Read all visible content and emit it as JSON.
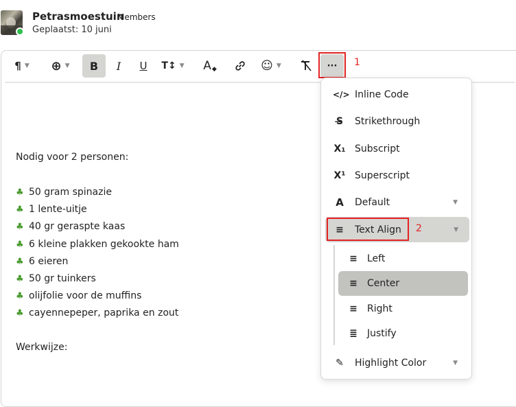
{
  "post": {
    "username": "Petrasmoestuin",
    "role": "Members",
    "posted": "Geplaatst: 10 juni"
  },
  "toolbar": {
    "buttons": [
      {
        "name": "paragraph",
        "icon": "paragraph-icon",
        "glyph": "¶"
      },
      {
        "name": "insert",
        "icon": "plus-circle-icon",
        "glyph": "⊕"
      },
      {
        "name": "bold",
        "icon": "bold-icon",
        "glyph": "B"
      },
      {
        "name": "italic",
        "icon": "italic-icon",
        "glyph": "I"
      },
      {
        "name": "underline",
        "icon": "underline-icon",
        "glyph": "U"
      },
      {
        "name": "font-size",
        "icon": "text-height-icon",
        "glyph": "T↕"
      },
      {
        "name": "font-color",
        "icon": "font-color-icon",
        "glyph": "A"
      },
      {
        "name": "link",
        "icon": "link-icon",
        "glyph": "🔗"
      },
      {
        "name": "emoji",
        "icon": "smiley-icon",
        "glyph": "☺"
      },
      {
        "name": "clear-format",
        "icon": "clear-format-icon",
        "glyph": "T̸"
      },
      {
        "name": "more",
        "icon": "ellipsis-icon",
        "glyph": "···"
      }
    ]
  },
  "annotations": {
    "one": "1",
    "two": "2"
  },
  "content": {
    "intro": "Nodig voor 2 personen:",
    "ingredients": [
      "50 gram spinazie",
      "1 lente-uitje",
      "40 gr geraspte kaas",
      "6 kleine plakken gekookte ham",
      "6 eieren",
      "50 gr tuinkers",
      "olijfolie voor de muffins",
      "cayennepeper, paprika en zout"
    ],
    "outro": "Werkwijze:"
  },
  "menu": {
    "items": [
      {
        "label": "Inline Code",
        "icon": "code-icon",
        "glyph": "</>"
      },
      {
        "label": "Strikethrough",
        "icon": "strikethrough-icon",
        "glyph": "S̶"
      },
      {
        "label": "Subscript",
        "icon": "subscript-icon",
        "glyph": "X₁"
      },
      {
        "label": "Superscript",
        "icon": "superscript-icon",
        "glyph": "X¹"
      },
      {
        "label": "Default",
        "icon": "font-icon",
        "glyph": "A"
      },
      {
        "label": "Text Align",
        "icon": "align-center-icon",
        "glyph": "≡"
      },
      {
        "label": "Highlight Color",
        "icon": "highlighter-icon",
        "glyph": "✎"
      }
    ],
    "align_options": [
      {
        "label": "Left",
        "icon": "align-left-icon",
        "glyph": "≡"
      },
      {
        "label": "Center",
        "icon": "align-center-icon",
        "glyph": "≡"
      },
      {
        "label": "Right",
        "icon": "align-right-icon",
        "glyph": "≡"
      },
      {
        "label": "Justify",
        "icon": "align-justify-icon",
        "glyph": "≣"
      }
    ],
    "selected_align": "Center"
  },
  "colors": {
    "annotation": "#e32222",
    "active_bg": "#d5d5d2",
    "online": "#2fbf4f"
  }
}
